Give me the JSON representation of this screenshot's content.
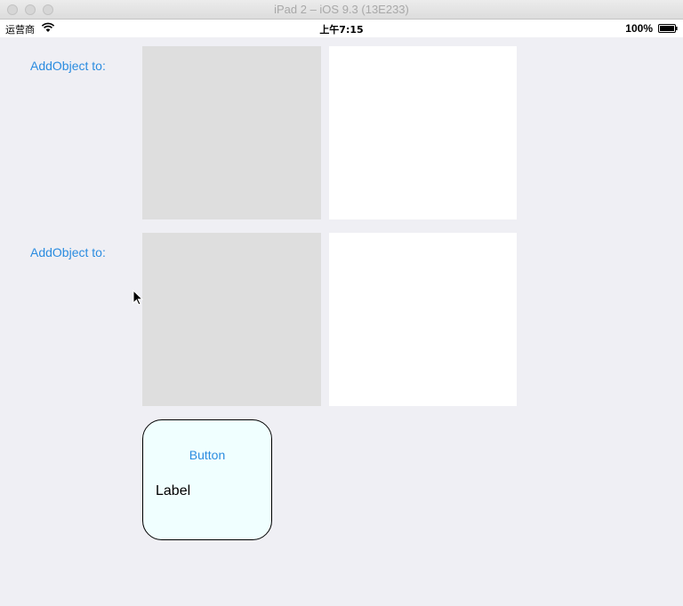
{
  "window": {
    "title": "iPad 2 – iOS 9.3 (13E233)"
  },
  "status_bar": {
    "carrier": "运营商",
    "time": "上午7:15",
    "battery": "100%"
  },
  "rows": [
    {
      "label": "AddObject to:"
    },
    {
      "label": "AddObject to:"
    }
  ],
  "card": {
    "button_label": "Button",
    "label": "Label"
  },
  "colors": {
    "accent": "#2b8ce0",
    "background": "#efeff4",
    "gray_box": "#dedede",
    "card_bg": "#f0ffff"
  },
  "icons": {
    "status": [
      "wifi-icon",
      "battery-icon"
    ],
    "pointer": "cursor-icon"
  }
}
